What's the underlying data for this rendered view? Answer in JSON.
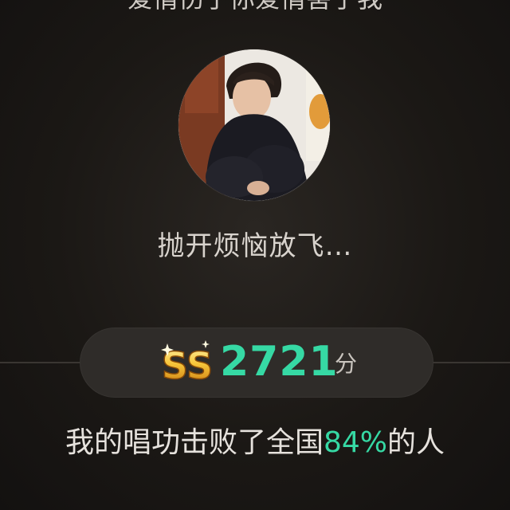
{
  "song": {
    "title": "爱情伤了你爱情害了我"
  },
  "profile": {
    "avatar_icon": "user-avatar-photo",
    "signature": "抛开烦恼放飞…"
  },
  "score": {
    "rank_badge_icon": "ss-rank-badge-icon",
    "rank_badge_text": "SS",
    "value": "2721",
    "unit": "分",
    "accent_color": "#36d9a4"
  },
  "result": {
    "prefix": "我的唱功击败了全国",
    "percent": "84%",
    "suffix": "的人"
  }
}
